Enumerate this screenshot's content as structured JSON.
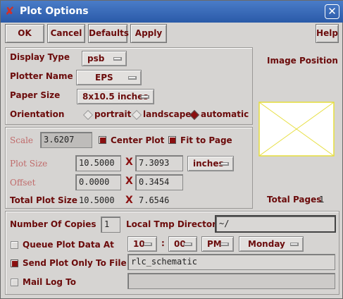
{
  "window": {
    "title": "Plot Options"
  },
  "toolbar": {
    "ok": "OK",
    "cancel": "Cancel",
    "defaults": "Defaults",
    "apply": "Apply",
    "help": "Help"
  },
  "display": {
    "display_type_label": "Display Type",
    "display_type_value": "psb",
    "plotter_label": "Plotter Name",
    "plotter_value": "EPS",
    "paper_label": "Paper Size",
    "paper_value": "8x10.5 inches",
    "orientation_label": "Orientation",
    "orientation_options": [
      "portrait",
      "landscape",
      "automatic"
    ],
    "orientation_selected": "automatic"
  },
  "image": {
    "position_label": "Image Position",
    "total_pages_label": "Total Pages",
    "total_pages_value": "1"
  },
  "scale": {
    "scale_label": "Scale",
    "scale_value": "3.6207",
    "center_plot_label": "Center Plot",
    "center_plot_checked": true,
    "fit_page_label": "Fit to Page",
    "fit_page_checked": true,
    "plot_size_label": "Plot Size",
    "plot_size_w": "10.5000",
    "plot_size_h": "7.3093",
    "units_value": "inches",
    "offset_label": "Offset",
    "offset_x": "0.0000",
    "offset_y": "0.3454",
    "total_size_label": "Total Plot Size",
    "total_size_w": "10.5000",
    "total_size_h": "7.6546",
    "times": "X"
  },
  "job": {
    "copies_label": "Number Of Copies",
    "copies_value": "1",
    "tmp_dir_label": "Local Tmp Directory",
    "tmp_dir_value": "~/",
    "queue_label": "Queue Plot Data At",
    "queue_checked": false,
    "hour": "10",
    "colon": ":",
    "minute": "00",
    "ampm": "PM",
    "day": "Monday",
    "send_file_label": "Send Plot Only To File",
    "send_file_checked": true,
    "file_value": "rlc_schematic",
    "mail_label": "Mail Log To",
    "mail_checked": false,
    "mail_value": ""
  }
}
